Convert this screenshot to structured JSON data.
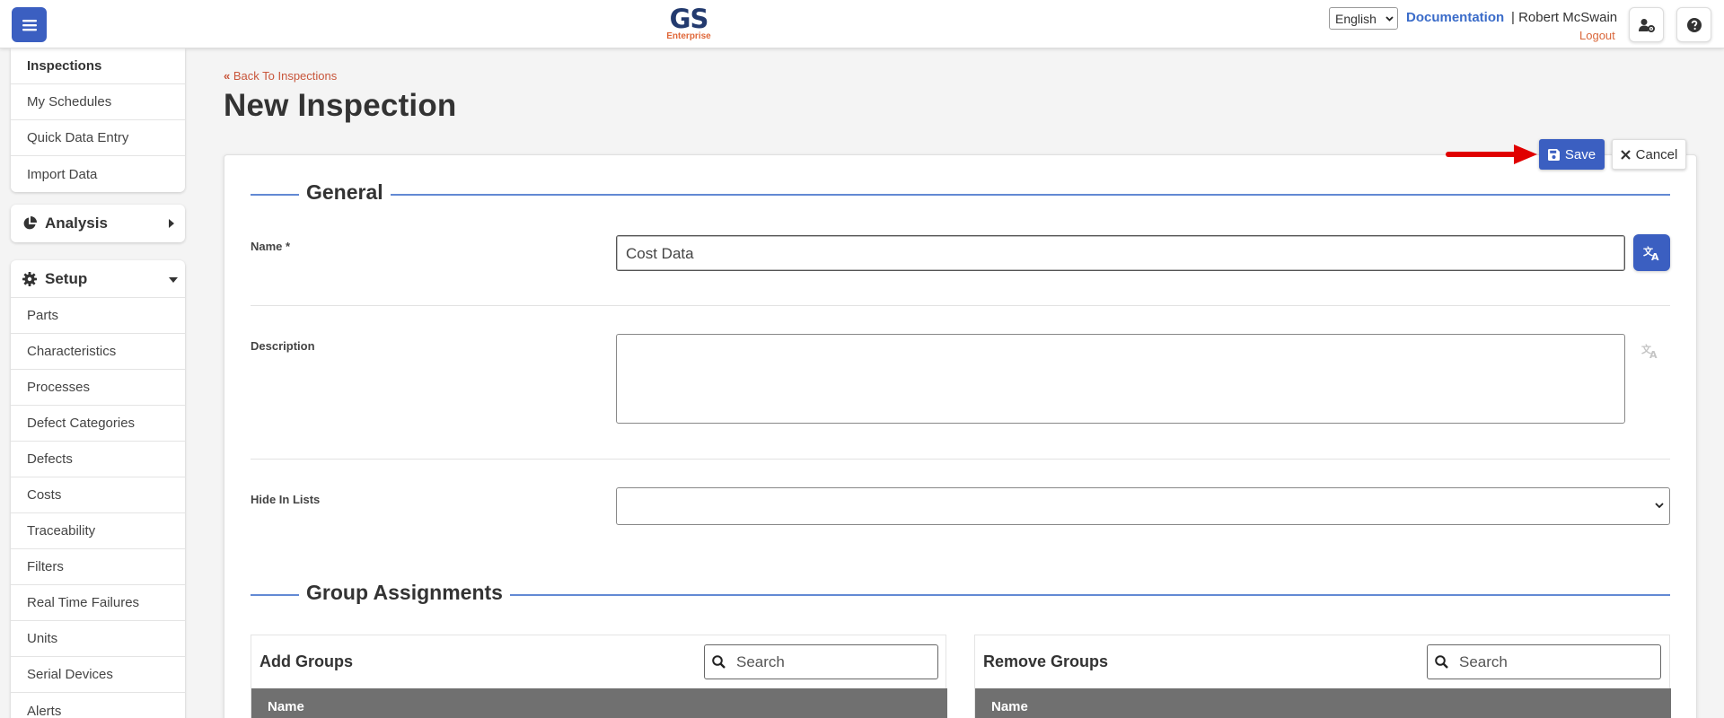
{
  "app": {
    "logo_main": "GS",
    "logo_sub": "Enterprise"
  },
  "header": {
    "language": "English",
    "documentation": "Documentation",
    "separator": "|",
    "user_name": "Robert McSwain",
    "logout": "Logout"
  },
  "sidebar": {
    "top_items": [
      {
        "label": "Inspections",
        "active": true
      },
      {
        "label": "My Schedules"
      },
      {
        "label": "Quick Data Entry"
      },
      {
        "label": "Import Data"
      }
    ],
    "analysis": {
      "label": "Analysis",
      "icon": "pie-chart-icon"
    },
    "setup": {
      "label": "Setup",
      "icon": "gear-icon",
      "items": [
        {
          "label": "Parts"
        },
        {
          "label": "Characteristics"
        },
        {
          "label": "Processes"
        },
        {
          "label": "Defect Categories"
        },
        {
          "label": "Defects"
        },
        {
          "label": "Costs"
        },
        {
          "label": "Traceability"
        },
        {
          "label": "Filters"
        },
        {
          "label": "Real Time Failures"
        },
        {
          "label": "Units"
        },
        {
          "label": "Serial Devices"
        },
        {
          "label": "Alerts"
        }
      ]
    }
  },
  "page": {
    "back_link": "Back To Inspections",
    "title": "New Inspection"
  },
  "toolbar": {
    "save_label": "Save",
    "cancel_label": "Cancel"
  },
  "general": {
    "legend": "General",
    "name_label": "Name *",
    "name_value": "Cost Data",
    "description_label": "Description",
    "description_value": "",
    "hide_in_lists_label": "Hide In Lists",
    "hide_in_lists_value": ""
  },
  "groups": {
    "legend": "Group Assignments",
    "add": {
      "title": "Add Groups",
      "search_placeholder": "Search",
      "column": "Name"
    },
    "remove": {
      "title": "Remove Groups",
      "search_placeholder": "Search",
      "column": "Name"
    }
  },
  "colors": {
    "primary": "#3b5fc1",
    "link": "#3b6cc9",
    "accent_orange": "#d9663a",
    "arrow_red": "#e00000",
    "table_header": "#707070"
  }
}
